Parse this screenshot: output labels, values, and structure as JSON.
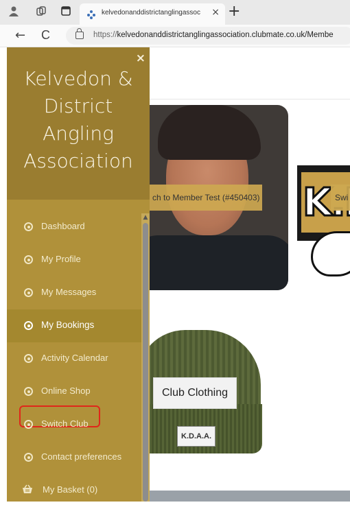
{
  "browser": {
    "tab_title": "kelvedonanddistrictanglingassoc",
    "tab_close": "×",
    "new_tab": "+",
    "back": "←",
    "refresh": "C",
    "url_prefix": "https://",
    "url_rest": "kelvedonanddistrictanglingassociation.clubmate.co.uk/Membe",
    "icons": [
      "profile-icon",
      "workspaces-icon",
      "tab-actions-icon",
      "site-favicon",
      "lock-icon"
    ]
  },
  "sidebar": {
    "close": "×",
    "title_lines": [
      "Kelvedon &",
      "District",
      "Angling",
      "Association"
    ],
    "items": [
      {
        "label": "Dashboard",
        "icon": "radio-dot-icon"
      },
      {
        "label": "My Profile",
        "icon": "radio-dot-icon"
      },
      {
        "label": "My Messages",
        "icon": "radio-dot-icon"
      },
      {
        "label": "My Bookings",
        "icon": "radio-dot-icon",
        "active": true
      },
      {
        "label": "Activity Calendar",
        "icon": "radio-dot-icon"
      },
      {
        "label": "Online Shop",
        "icon": "radio-dot-icon"
      },
      {
        "label": "Switch Club",
        "icon": "radio-dot-icon",
        "highlighted": true
      },
      {
        "label": "Contact preferences",
        "icon": "radio-dot-icon"
      },
      {
        "label": "My Basket (0)",
        "icon": "basket-icon"
      }
    ],
    "colors": {
      "header": "#9a7d30",
      "body": "#b0913a",
      "highlight": "#e0261a"
    }
  },
  "main": {
    "switch_member": "ch to Member Test (#450403)",
    "switch_other": "Swi",
    "logo_letters": "K.D",
    "hat_badge": "K.D.A.A.",
    "club_clothing": "Club Clothing"
  }
}
